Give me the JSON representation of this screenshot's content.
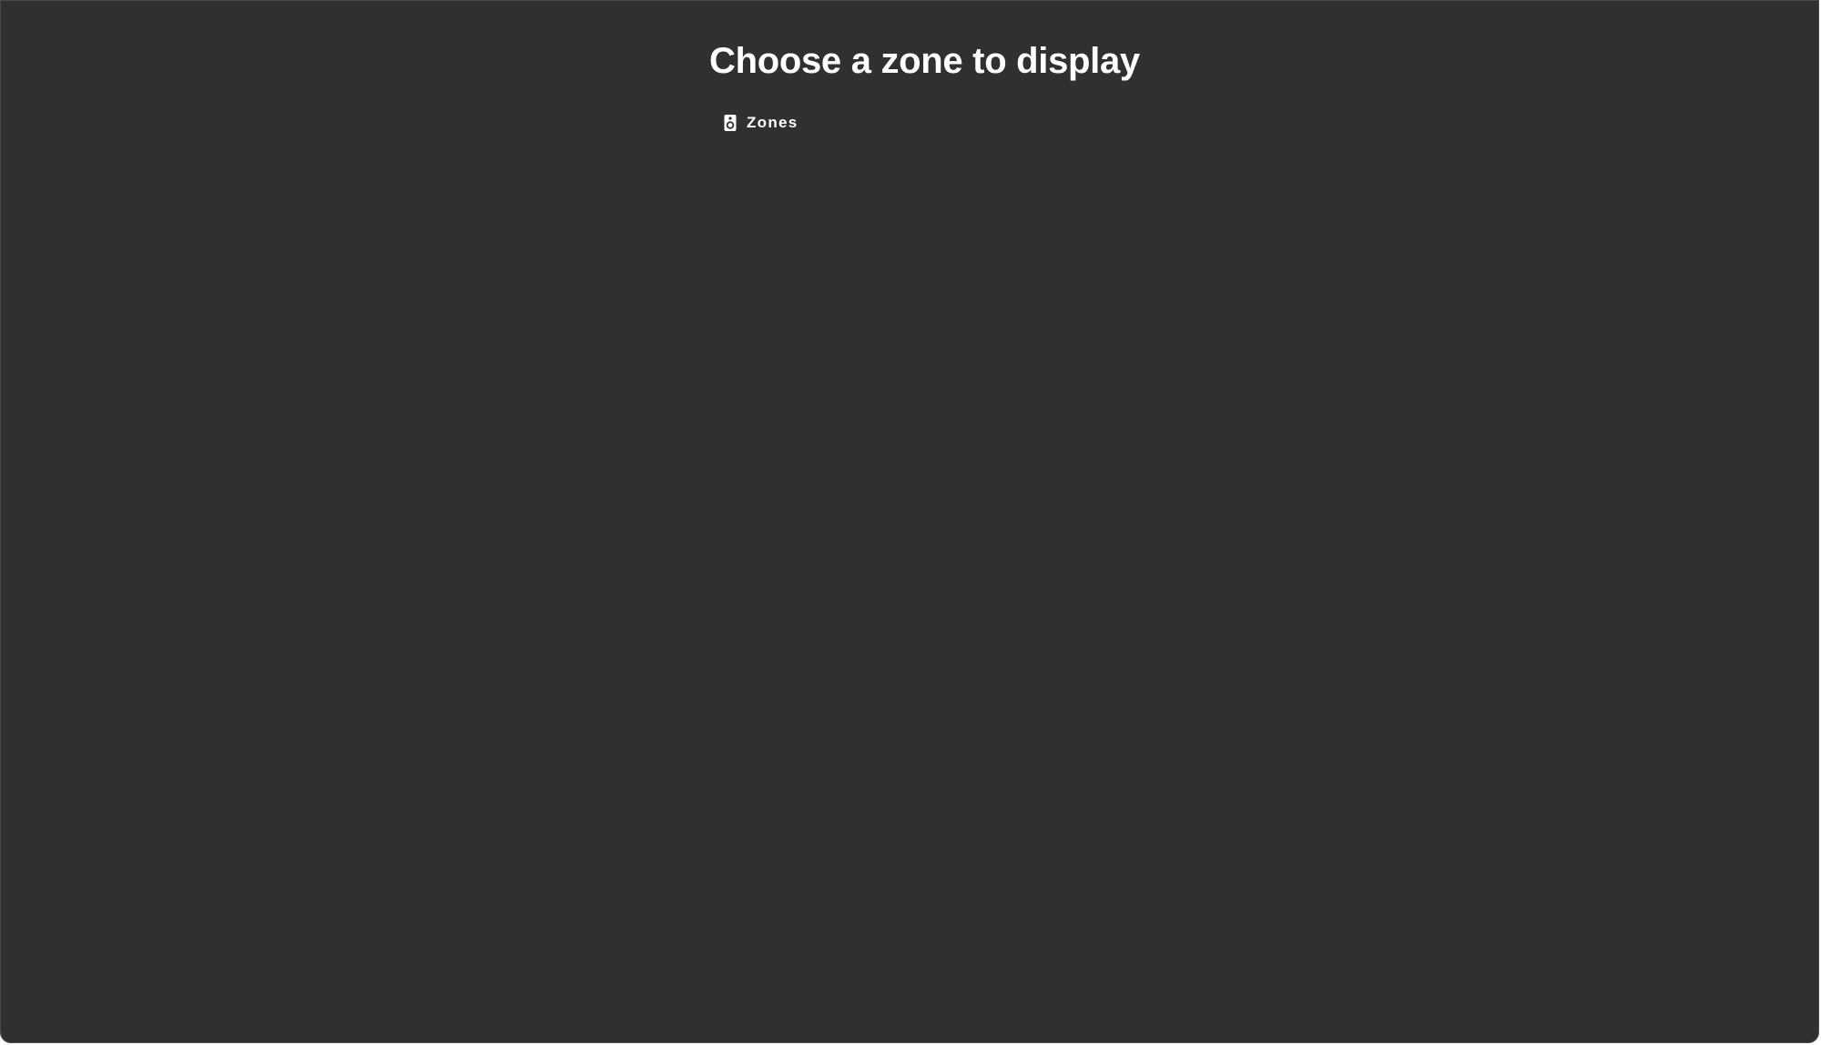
{
  "page": {
    "title": "Choose a zone to display"
  },
  "zones_button": {
    "icon": "speaker-icon",
    "label": "Zones"
  },
  "colors": {
    "background": "#303030",
    "text": "#ffffff"
  }
}
